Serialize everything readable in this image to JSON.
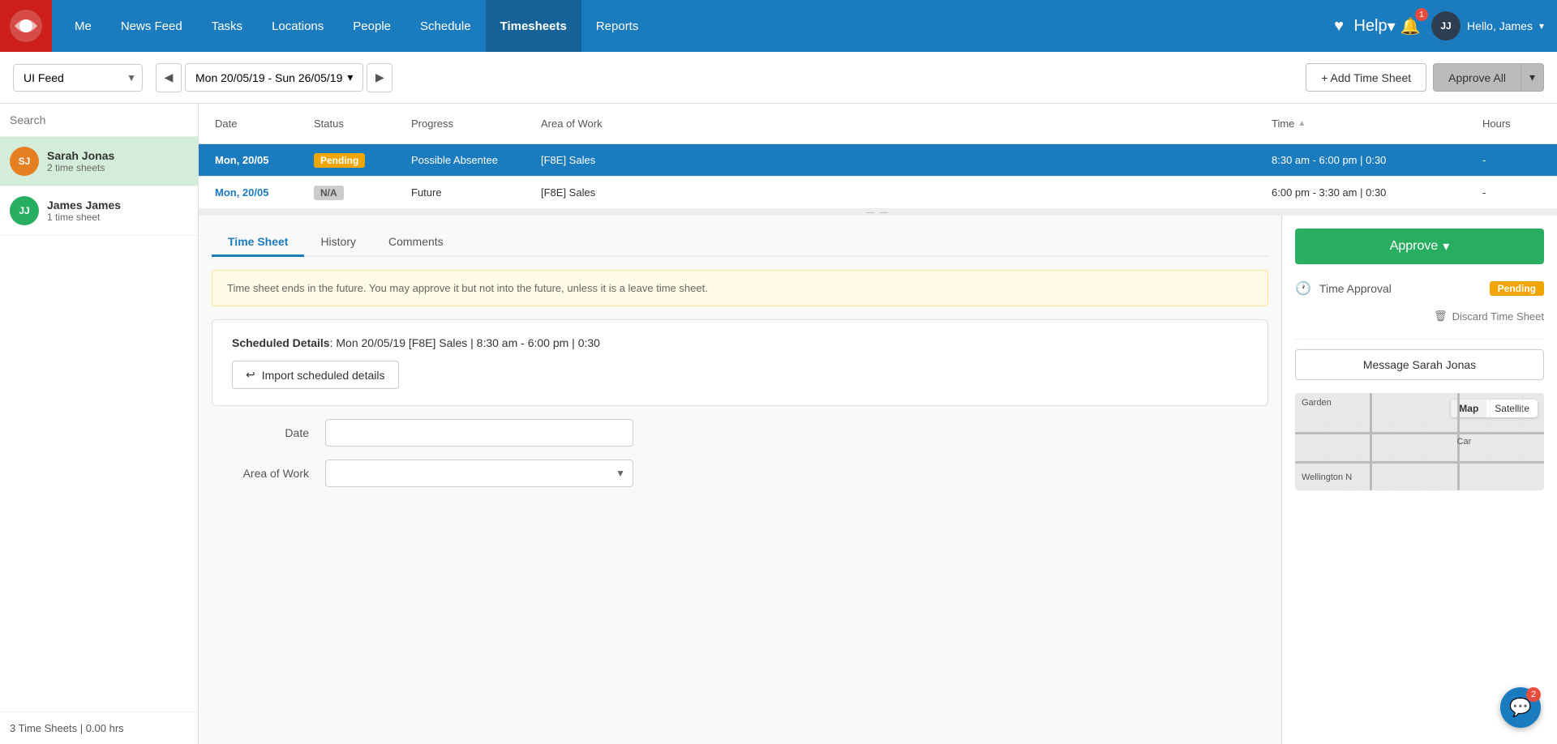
{
  "nav": {
    "logo_alt": "Logo",
    "links": [
      {
        "label": "Me",
        "name": "nav-me",
        "active": false
      },
      {
        "label": "News Feed",
        "name": "nav-news-feed",
        "active": false
      },
      {
        "label": "Tasks",
        "name": "nav-tasks",
        "active": false
      },
      {
        "label": "Locations",
        "name": "nav-locations",
        "active": false
      },
      {
        "label": "People",
        "name": "nav-people",
        "active": false
      },
      {
        "label": "Schedule",
        "name": "nav-schedule",
        "active": false
      },
      {
        "label": "Timesheets",
        "name": "nav-timesheets",
        "active": true
      },
      {
        "label": "Reports",
        "name": "nav-reports",
        "active": false
      }
    ],
    "help_label": "Help",
    "user_initials": "JJ",
    "user_greeting": "Hello, James",
    "notification_count": "1",
    "chat_count": "2"
  },
  "toolbar": {
    "feed_select": "UI Feed",
    "feed_select_placeholder": "UI Feed",
    "date_range": "Mon 20/05/19 - Sun 26/05/19",
    "add_timesheet_label": "+ Add Time Sheet",
    "approve_all_label": "Approve All"
  },
  "table": {
    "columns": {
      "date": "Date",
      "status": "Status",
      "progress": "Progress",
      "area_of_work": "Area of Work",
      "time": "Time",
      "hours": "Hours"
    },
    "rows": [
      {
        "date": "Mon, 20/05",
        "status": "Pending",
        "status_type": "pending",
        "progress": "Possible Absentee",
        "area": "[F8E] Sales",
        "time": "8:30 am - 6:00 pm | 0:30",
        "hours": "-",
        "highlighted": true
      },
      {
        "date": "Mon, 20/05",
        "status": "N/A",
        "status_type": "na",
        "progress": "Future",
        "area": "[F8E] Sales",
        "time": "6:00 pm - 3:30 am | 0:30",
        "hours": "-",
        "highlighted": false
      }
    ]
  },
  "employees": [
    {
      "name": "Sarah Jonas",
      "initials": "SJ",
      "color": "#e67e22",
      "sheets": "2 time sheets",
      "selected": true
    },
    {
      "name": "James James",
      "initials": "JJ",
      "color": "#27ae60",
      "sheets": "1 time sheet",
      "selected": false
    }
  ],
  "footer": {
    "summary": "3 Time Sheets | 0.00 hrs"
  },
  "tabs": [
    {
      "label": "Time Sheet",
      "active": true
    },
    {
      "label": "History",
      "active": false
    },
    {
      "label": "Comments",
      "active": false
    }
  ],
  "detail": {
    "warning": "Time sheet ends in the future. You may approve it but not into the future, unless it is a leave time sheet.",
    "scheduled_label": "Scheduled Details",
    "scheduled_value": ": Mon 20/05/19 [F8E] Sales | 8:30 am - 6:00 pm | 0:30",
    "import_btn_label": "Import scheduled details",
    "form": {
      "date_label": "Date",
      "area_label": "Area of Work"
    }
  },
  "sidebar": {
    "approve_label": "Approve",
    "time_approval_label": "Time Approval",
    "pending_label": "Pending",
    "discard_label": "Discard Time Sheet",
    "message_label": "Message Sarah Jonas",
    "map_label": "Map",
    "satellite_label": "Satellite",
    "map_labels": [
      "Garden",
      "Car",
      "Wellington N"
    ]
  },
  "search": {
    "placeholder": "Search"
  }
}
